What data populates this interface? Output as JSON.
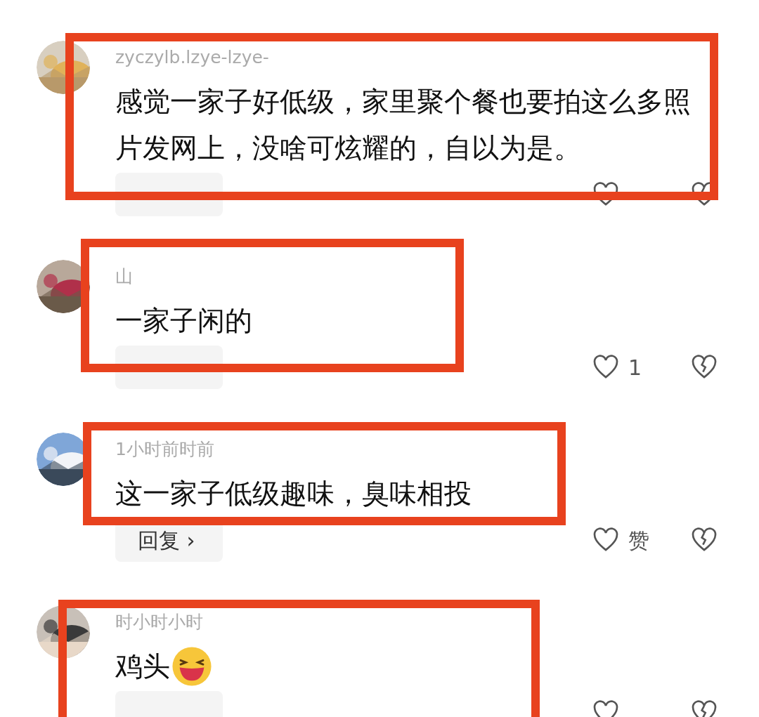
{
  "comments": [
    {
      "meta": "zyczylb.lzye-lzye-",
      "text": "感觉一家子好低级，家里聚个餐也要拍这么多照片发网上，没啥可炫耀的，自以为是。",
      "emoji": false,
      "highlighted": true
    },
    {
      "meta": "山",
      "text": "一家子闲的",
      "emoji": false,
      "likes": "1",
      "highlighted": true
    },
    {
      "meta": "1小时前时前",
      "text": "这一家子低级趣味，臭味相投",
      "emoji": false,
      "reply": "回复 ›",
      "likes": "赞",
      "highlighted": true
    },
    {
      "meta": "时小时小时",
      "text": "鸡头",
      "emoji": true,
      "highlighted": true
    }
  ]
}
